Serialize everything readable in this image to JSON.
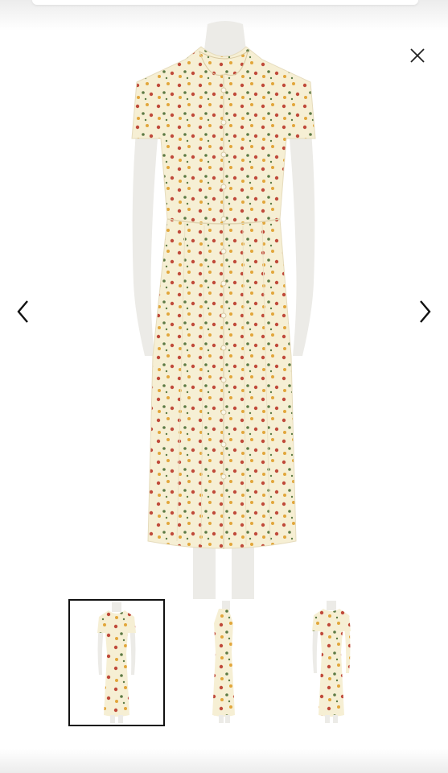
{
  "viewer": {
    "controls": {
      "close_icon": "close-icon",
      "prev_icon": "chevron-left-icon",
      "next_icon": "chevron-right-icon"
    },
    "main_image": {
      "subject": "floral-print-shirt-dress-on-mannequin",
      "fabric_color": "#f6efd4",
      "print_colors": [
        "#c04a3a",
        "#e2a63a",
        "#5d7a45"
      ]
    },
    "thumbnails": [
      {
        "view": "front",
        "selected": true
      },
      {
        "view": "side",
        "selected": false
      },
      {
        "view": "back",
        "selected": false
      }
    ],
    "colors": {
      "background": "#ffffff",
      "icon": "#222222",
      "selected_border": "#111111",
      "mannequin": "#ecebe7"
    }
  }
}
